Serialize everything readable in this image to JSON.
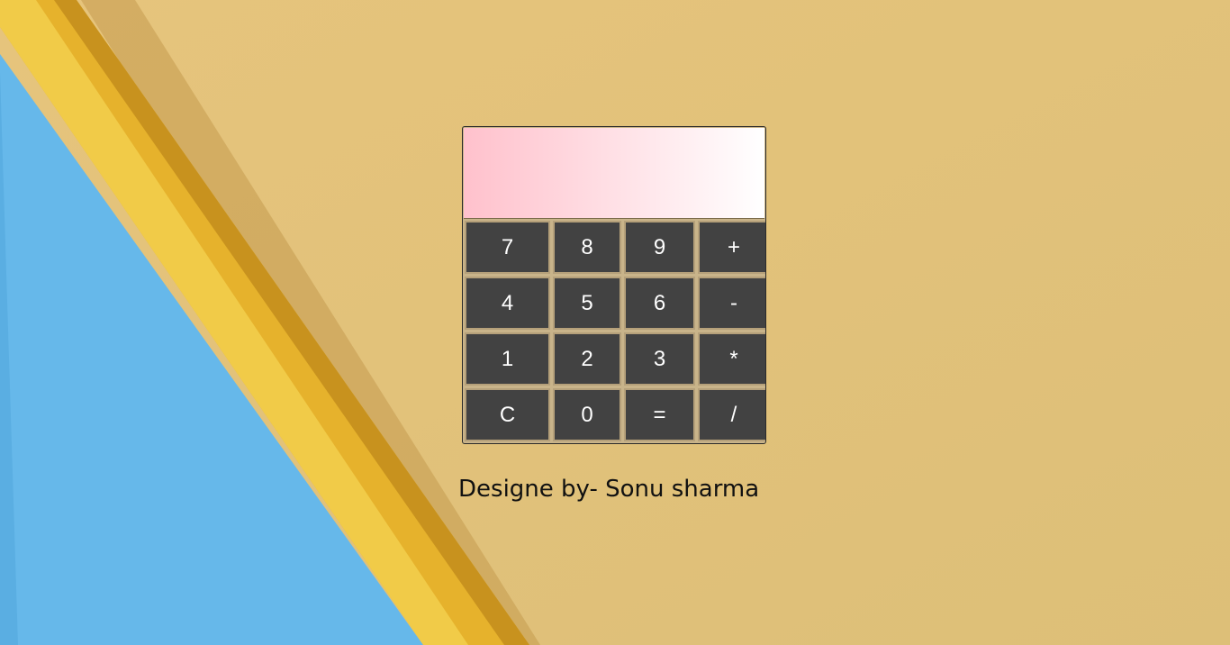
{
  "calculator": {
    "display_value": "",
    "keys": [
      {
        "label": "7",
        "name": "key-7"
      },
      {
        "label": "8",
        "name": "key-8"
      },
      {
        "label": "9",
        "name": "key-9"
      },
      {
        "label": "+",
        "name": "key-plus"
      },
      {
        "label": "4",
        "name": "key-4"
      },
      {
        "label": "5",
        "name": "key-5"
      },
      {
        "label": "6",
        "name": "key-6"
      },
      {
        "label": "-",
        "name": "key-minus"
      },
      {
        "label": "1",
        "name": "key-1"
      },
      {
        "label": "2",
        "name": "key-2"
      },
      {
        "label": "3",
        "name": "key-3"
      },
      {
        "label": "*",
        "name": "key-multiply"
      },
      {
        "label": "C",
        "name": "key-clear"
      },
      {
        "label": "0",
        "name": "key-0"
      },
      {
        "label": "=",
        "name": "key-equals"
      },
      {
        "label": "/",
        "name": "key-divide"
      }
    ]
  },
  "footer": {
    "credit": "Designe by- Sonu sharma"
  },
  "colors": {
    "key_background": "#424242",
    "key_text": "#ffffff",
    "display_gradient_start": "#ffc1cc",
    "display_gradient_end": "#ffffff",
    "paper_background": "#e2c27a",
    "blue_paper": "#66b8ea",
    "pencil_yellow": "#e8b52a"
  }
}
